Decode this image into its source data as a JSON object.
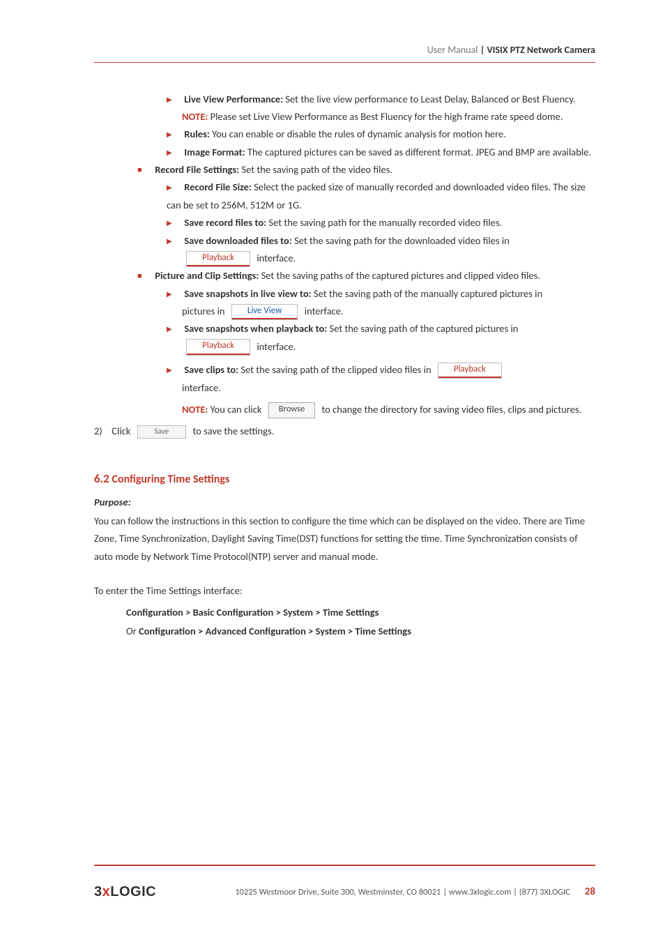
{
  "header": {
    "left": "User Manual",
    "right": "| VISIX PTZ Network Camera"
  },
  "items": {
    "liveViewPerf": {
      "label": "Live View Performance:",
      "text": " Set the live view performance to Least Delay, Balanced or Best Fluency."
    },
    "liveViewNote": {
      "label": "NOTE:",
      "text": " Please set Live View Performance as Best Fluency for the high frame rate speed dome."
    },
    "rules": {
      "label": "Rules:",
      "text": " You can enable or disable the rules of dynamic analysis for motion here."
    },
    "imageFormat": {
      "label": "Image Format:",
      "text": " The captured pictures can be saved as different format. JPEG and BMP are available."
    },
    "recordFileSettings": {
      "label": "Record File Settings:",
      "text": " Set the saving path of the video files."
    },
    "recordFileSize": {
      "label": "Record File Size:",
      "text": " Select the packed size of manually recorded and downloaded video files. The size can be set to 256M, 512M or 1G."
    },
    "saveRecord": {
      "label": "Save record files to:",
      "text": " Set the saving path for the manually recorded video files."
    },
    "saveDownloaded": {
      "label": "Save downloaded files to:",
      "text": " Set the saving path for the downloaded video files in",
      "trailing": " interface."
    },
    "pictureClip": {
      "label": "Picture and Clip Settings:",
      "text": " Set the saving paths of the captured pictures and clipped video files."
    },
    "snapLive": {
      "label": "Save snapshots in live view to:",
      "text": " Set the saving path of the manually captured pictures in ",
      "trailing": " interface."
    },
    "snapPlayback": {
      "label": "Save snapshots when playback to:",
      "text": " Set the saving path of the captured pictures in",
      "trailing": " interface."
    },
    "saveClips": {
      "label": "Save clips to:",
      "text": " Set the saving path of the clipped video files in ",
      "trailing": "interface."
    },
    "browseNote": {
      "label": "NOTE:",
      "pre": " You can click ",
      "post": " to change the directory for saving video files, clips and pictures."
    },
    "step2": {
      "num": "2)",
      "pre": "Click ",
      "post": " to save the settings."
    }
  },
  "buttons": {
    "playback": "Playback",
    "liveview": "Live View",
    "browse": "Browse",
    "save": "Save"
  },
  "section62": {
    "num": "6.2",
    "title": " Configuring Time Settings",
    "purpose": "Purpose:",
    "body": "You can follow the instructions in this section to configure the time which can be displayed on the video. There are Time Zone, Time Synchronization, Daylight Saving Time(DST) functions for setting the time. Time Synchronization consists of auto mode by Network Time Protocol(NTP) server and manual mode.",
    "toEnter": "To enter the Time Settings interface:",
    "path1": "Configuration > Basic Configuration > System > Time Settings",
    "or": "Or ",
    "path2": "Configuration > Advanced Configuration > System > Time Settings"
  },
  "footer": {
    "logo": {
      "pre": "3",
      "x": "x",
      "post": "LOGIC"
    },
    "address": "10225 Westmoor Drive, Suite 300, Westminster, CO 80021 | www.3xlogic.com | (877) 3XLOGIC",
    "page": "28"
  }
}
